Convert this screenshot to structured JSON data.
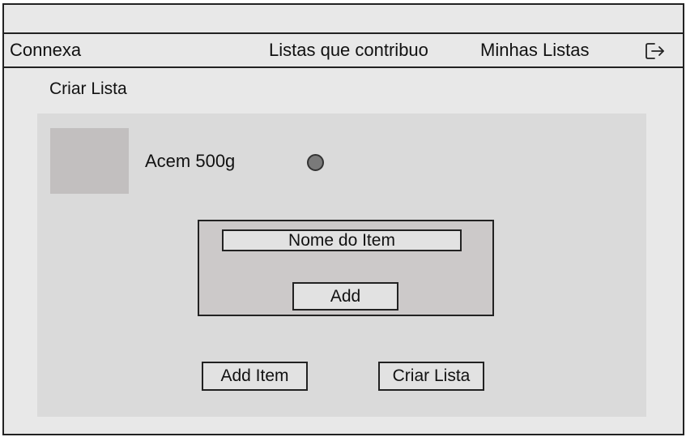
{
  "header": {
    "brand": "Connexa",
    "nav": {
      "contributed_lists": "Listas que contribuo",
      "my_lists": "Minhas Listas"
    },
    "logout_icon": "logout-icon"
  },
  "page": {
    "title": "Criar Lista"
  },
  "items": [
    {
      "name": "Acem 500g",
      "thumbnail_icon": "image-placeholder"
    }
  ],
  "add_item_dialog": {
    "input_placeholder": "Nome do Item",
    "add_label": "Add"
  },
  "actions": {
    "add_item_label": "Add Item",
    "create_list_label": "Criar Lista"
  },
  "colors": {
    "background": "#e8e8e8",
    "panel": "#dadada",
    "dialog": "#ccc9c9",
    "thumbnail": "#c2bfbf",
    "dot": "#7a7a7a",
    "border": "#222222"
  }
}
